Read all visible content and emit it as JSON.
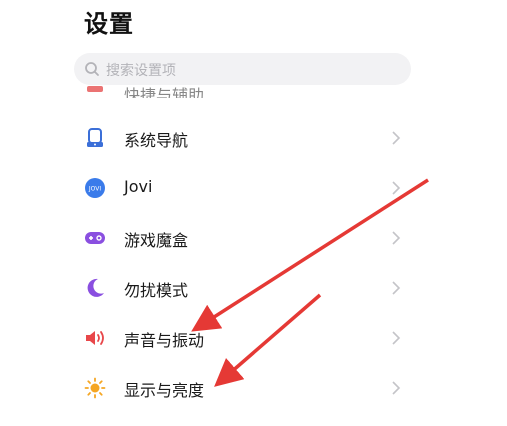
{
  "header": {
    "title": "设置"
  },
  "search": {
    "placeholder": "搜索设置项"
  },
  "list": {
    "partial_item_label": "快捷与辅助",
    "items": [
      {
        "label": "系统导航",
        "icon": "navigation-icon",
        "color": "#3b6fd8"
      },
      {
        "label": "Jovi",
        "icon": "jovi-icon",
        "color": "#3a7bea"
      },
      {
        "label": "游戏魔盒",
        "icon": "gamepad-icon",
        "color": "#8a4fe0"
      },
      {
        "label": "勿扰模式",
        "icon": "moon-icon",
        "color": "#8a4fe0"
      },
      {
        "label": "声音与振动",
        "icon": "speaker-icon",
        "color": "#e8474a"
      },
      {
        "label": "显示与亮度",
        "icon": "sun-icon",
        "color": "#f5a623"
      }
    ]
  },
  "annotations": {
    "arrow_color": "#e53935",
    "arrow_targets": [
      "声音与振动",
      "显示与亮度"
    ]
  },
  "icons": {
    "search": "search-icon",
    "chevron": "chevron-right-icon",
    "jovi_text": "JOVI"
  }
}
